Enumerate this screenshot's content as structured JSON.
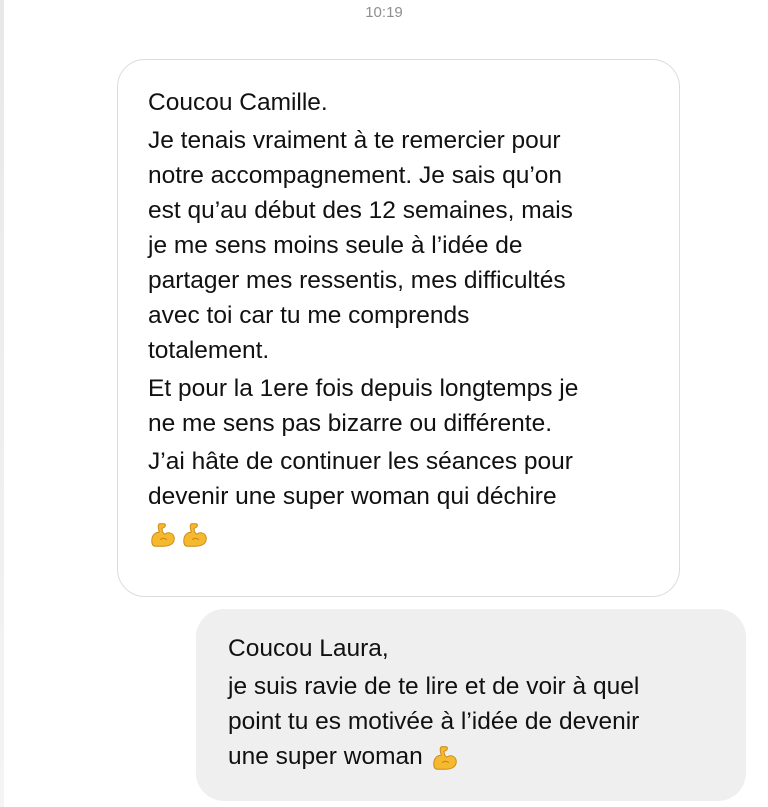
{
  "thread": {
    "timestamp": "10:19"
  },
  "messages": [
    {
      "direction": "received",
      "lines": [
        "Coucou Camille.",
        "Je tenais vraiment à te remercier pour",
        "notre accompagnement. Je sais qu’on",
        "est qu’au début des 12 semaines, mais",
        "je me sens moins seule à l’idée de",
        "partager mes ressentis, mes difficultés",
        "avec toi car tu me comprends",
        "totalement.",
        "Et pour la 1ere fois depuis longtemps je",
        "ne me sens pas bizarre ou différente.",
        "J’ai hâte de continuer les séances pour",
        "devenir une super woman qui déchire"
      ],
      "emoji": "flexed-biceps-icon ×2"
    },
    {
      "direction": "sent",
      "lines": [
        "Coucou Laura,",
        "je suis ravie de te lire et de voir à quel",
        "point tu es motivée à l’idée de devenir",
        "une super woman"
      ],
      "emoji": "flexed-biceps-icon"
    }
  ],
  "colors": {
    "received_bubble_bg": "#ffffff",
    "received_bubble_border": "#dcdcdc",
    "sent_bubble_bg": "#efefef",
    "text": "#111111",
    "timestamp": "#8e8e93",
    "emoji": "#f5b82e"
  }
}
